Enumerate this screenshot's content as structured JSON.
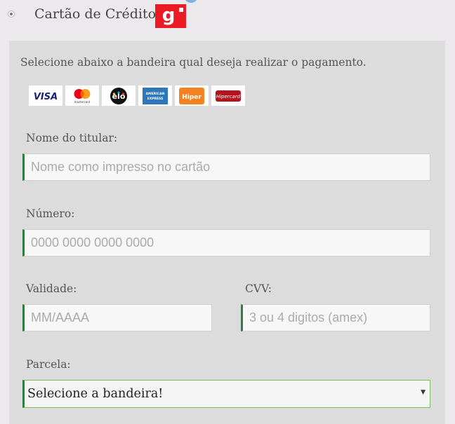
{
  "payment_method": {
    "title": "Cartão de Crédito",
    "logo_letter": "g",
    "brand_color": "#ea1b25"
  },
  "intro_text": "Selecione abaixo a bandeira qual deseja realizar o pagamento.",
  "brands": [
    {
      "name": "Visa",
      "label": "VISA"
    },
    {
      "name": "Mastercard",
      "label": "mastercard"
    },
    {
      "name": "Elo",
      "label": "elo"
    },
    {
      "name": "American Express",
      "label": "AMERICAN EXPRESS"
    },
    {
      "name": "Hiper",
      "label": "Hiper"
    },
    {
      "name": "Hipercard",
      "label": "Hipercard"
    }
  ],
  "form": {
    "holder": {
      "label": "Nome do titular:",
      "placeholder": "Nome como impresso no cartão",
      "value": ""
    },
    "number": {
      "label": "Número:",
      "placeholder": "0000 0000 0000 0000",
      "value": ""
    },
    "expiry": {
      "label": "Validade:",
      "placeholder": "MM/AAAA",
      "value": ""
    },
    "cvv": {
      "label": "CVV:",
      "placeholder": "3 ou 4 digitos (amex)",
      "value": ""
    },
    "installments": {
      "label": "Parcela:",
      "selected": "Selecione a bandeira!"
    }
  },
  "colors": {
    "accent_border": "#2e7d43",
    "select_border": "#7bbd5a",
    "panel_bg": "#dddcdd"
  }
}
